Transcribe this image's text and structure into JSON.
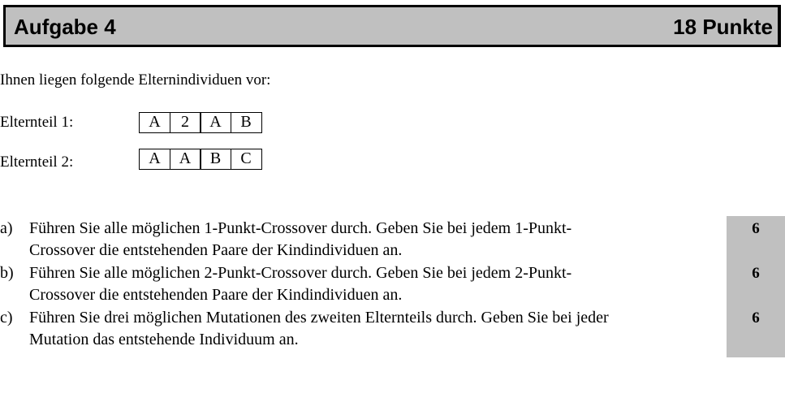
{
  "header": {
    "title": "Aufgabe 4",
    "points": "18 Punkte"
  },
  "intro": "Ihnen liegen folgende Elternindividuen vor:",
  "parents": [
    {
      "label": "Elternteil 1:",
      "genes": [
        "A",
        "2",
        "A",
        "B"
      ]
    },
    {
      "label": "Elternteil 2:",
      "genes": [
        "A",
        "A",
        "B",
        "C"
      ]
    }
  ],
  "tasks": [
    {
      "letter": "a)",
      "line1": "Führen Sie alle möglichen 1-Punkt-Crossover durch. Geben Sie bei jedem 1-Punkt-",
      "line2": "Crossover die entstehenden Paare der Kindindividuen an.",
      "points": "6"
    },
    {
      "letter": "b)",
      "line1": "Führen Sie alle möglichen 2-Punkt-Crossover durch. Geben Sie bei jedem 2-Punkt-",
      "line2": "Crossover die entstehenden Paare der Kindindividuen an.",
      "points": "6"
    },
    {
      "letter": "c)",
      "line1": "Führen Sie drei möglichen Mutationen des zweiten Elternteils durch. Geben Sie bei jeder",
      "line2": "Mutation das entstehende Individuum an.",
      "points": "6"
    }
  ]
}
